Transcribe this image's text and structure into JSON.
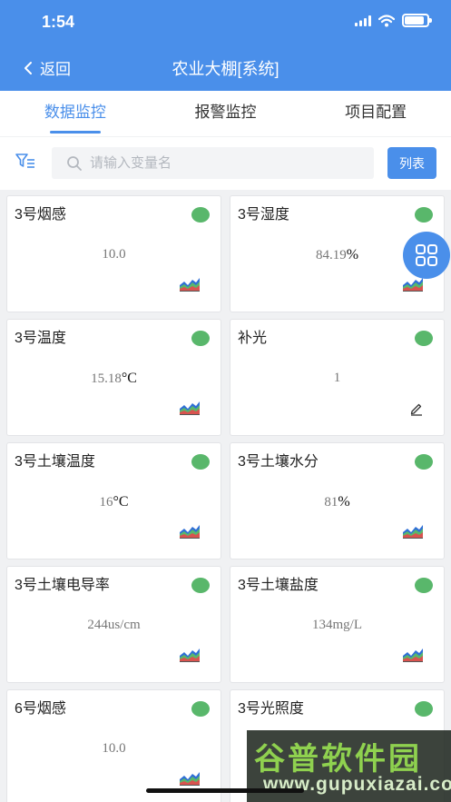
{
  "status_bar": {
    "time": "1:54"
  },
  "header": {
    "back_label": "返回",
    "title": "农业大棚[系统]"
  },
  "tabs": [
    {
      "label": "数据监控",
      "active": true
    },
    {
      "label": "报警监控",
      "active": false
    },
    {
      "label": "项目配置",
      "active": false
    }
  ],
  "search": {
    "placeholder": "请输入变量名",
    "value": "",
    "list_button": "列表"
  },
  "cards": [
    {
      "name": "3号烟感",
      "value": "10.0",
      "unit": "",
      "status": "online",
      "action": "chart-icon"
    },
    {
      "name": "3号湿度",
      "value": "84.19",
      "unit": "%",
      "status": "online",
      "action": "chart-icon"
    },
    {
      "name": "3号温度",
      "value": "15.18",
      "unit": "°C",
      "status": "online",
      "action": "chart-icon"
    },
    {
      "name": "补光",
      "value": "1",
      "unit": "",
      "status": "online",
      "action": "edit-icon"
    },
    {
      "name": "3号土壤温度",
      "value": "16",
      "unit": "°C",
      "status": "online",
      "action": "chart-icon"
    },
    {
      "name": "3号土壤水分",
      "value": "81",
      "unit": "%",
      "status": "online",
      "action": "chart-icon"
    },
    {
      "name": "3号土壤电导率",
      "value": "244us/cm",
      "unit": "",
      "status": "online",
      "action": "chart-icon"
    },
    {
      "name": "3号土壤盐度",
      "value": "134mg/L",
      "unit": "",
      "status": "online",
      "action": "chart-icon"
    },
    {
      "name": "6号烟感",
      "value": "10.0",
      "unit": "",
      "status": "online",
      "action": "chart-icon"
    },
    {
      "name": "3号光照度",
      "value": "",
      "unit": "",
      "status": "online",
      "action": ""
    }
  ],
  "colors": {
    "primary": "#4a8fea",
    "status_online": "#59b76b",
    "chart_red": "#d9534f",
    "chart_green": "#59b76b",
    "chart_blue": "#2f6fd6"
  },
  "watermark": {
    "cn": "谷普软件园",
    "en": "www.gupuxiazai.com"
  }
}
